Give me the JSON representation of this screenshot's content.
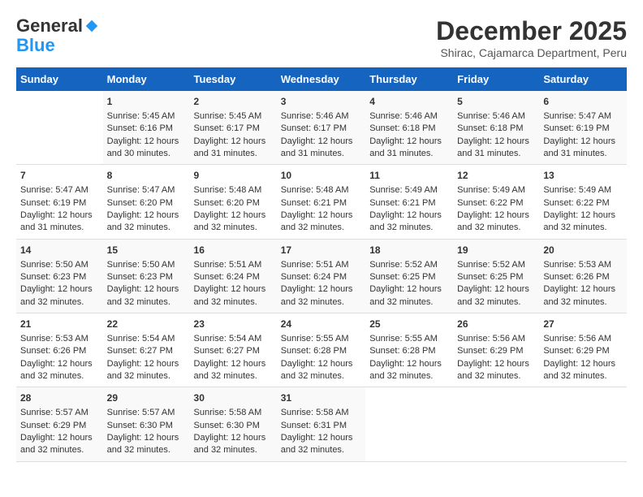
{
  "header": {
    "logo_line1": "General",
    "logo_line2": "Blue",
    "month_title": "December 2025",
    "location": "Shirac, Cajamarca Department, Peru"
  },
  "days_of_week": [
    "Sunday",
    "Monday",
    "Tuesday",
    "Wednesday",
    "Thursday",
    "Friday",
    "Saturday"
  ],
  "weeks": [
    [
      {
        "day": "",
        "sunrise": "",
        "sunset": "",
        "daylight": ""
      },
      {
        "day": "1",
        "sunrise": "Sunrise: 5:45 AM",
        "sunset": "Sunset: 6:16 PM",
        "daylight": "Daylight: 12 hours and 30 minutes."
      },
      {
        "day": "2",
        "sunrise": "Sunrise: 5:45 AM",
        "sunset": "Sunset: 6:17 PM",
        "daylight": "Daylight: 12 hours and 31 minutes."
      },
      {
        "day": "3",
        "sunrise": "Sunrise: 5:46 AM",
        "sunset": "Sunset: 6:17 PM",
        "daylight": "Daylight: 12 hours and 31 minutes."
      },
      {
        "day": "4",
        "sunrise": "Sunrise: 5:46 AM",
        "sunset": "Sunset: 6:18 PM",
        "daylight": "Daylight: 12 hours and 31 minutes."
      },
      {
        "day": "5",
        "sunrise": "Sunrise: 5:46 AM",
        "sunset": "Sunset: 6:18 PM",
        "daylight": "Daylight: 12 hours and 31 minutes."
      },
      {
        "day": "6",
        "sunrise": "Sunrise: 5:47 AM",
        "sunset": "Sunset: 6:19 PM",
        "daylight": "Daylight: 12 hours and 31 minutes."
      }
    ],
    [
      {
        "day": "7",
        "sunrise": "Sunrise: 5:47 AM",
        "sunset": "Sunset: 6:19 PM",
        "daylight": "Daylight: 12 hours and 31 minutes."
      },
      {
        "day": "8",
        "sunrise": "Sunrise: 5:47 AM",
        "sunset": "Sunset: 6:20 PM",
        "daylight": "Daylight: 12 hours and 32 minutes."
      },
      {
        "day": "9",
        "sunrise": "Sunrise: 5:48 AM",
        "sunset": "Sunset: 6:20 PM",
        "daylight": "Daylight: 12 hours and 32 minutes."
      },
      {
        "day": "10",
        "sunrise": "Sunrise: 5:48 AM",
        "sunset": "Sunset: 6:21 PM",
        "daylight": "Daylight: 12 hours and 32 minutes."
      },
      {
        "day": "11",
        "sunrise": "Sunrise: 5:49 AM",
        "sunset": "Sunset: 6:21 PM",
        "daylight": "Daylight: 12 hours and 32 minutes."
      },
      {
        "day": "12",
        "sunrise": "Sunrise: 5:49 AM",
        "sunset": "Sunset: 6:22 PM",
        "daylight": "Daylight: 12 hours and 32 minutes."
      },
      {
        "day": "13",
        "sunrise": "Sunrise: 5:49 AM",
        "sunset": "Sunset: 6:22 PM",
        "daylight": "Daylight: 12 hours and 32 minutes."
      }
    ],
    [
      {
        "day": "14",
        "sunrise": "Sunrise: 5:50 AM",
        "sunset": "Sunset: 6:23 PM",
        "daylight": "Daylight: 12 hours and 32 minutes."
      },
      {
        "day": "15",
        "sunrise": "Sunrise: 5:50 AM",
        "sunset": "Sunset: 6:23 PM",
        "daylight": "Daylight: 12 hours and 32 minutes."
      },
      {
        "day": "16",
        "sunrise": "Sunrise: 5:51 AM",
        "sunset": "Sunset: 6:24 PM",
        "daylight": "Daylight: 12 hours and 32 minutes."
      },
      {
        "day": "17",
        "sunrise": "Sunrise: 5:51 AM",
        "sunset": "Sunset: 6:24 PM",
        "daylight": "Daylight: 12 hours and 32 minutes."
      },
      {
        "day": "18",
        "sunrise": "Sunrise: 5:52 AM",
        "sunset": "Sunset: 6:25 PM",
        "daylight": "Daylight: 12 hours and 32 minutes."
      },
      {
        "day": "19",
        "sunrise": "Sunrise: 5:52 AM",
        "sunset": "Sunset: 6:25 PM",
        "daylight": "Daylight: 12 hours and 32 minutes."
      },
      {
        "day": "20",
        "sunrise": "Sunrise: 5:53 AM",
        "sunset": "Sunset: 6:26 PM",
        "daylight": "Daylight: 12 hours and 32 minutes."
      }
    ],
    [
      {
        "day": "21",
        "sunrise": "Sunrise: 5:53 AM",
        "sunset": "Sunset: 6:26 PM",
        "daylight": "Daylight: 12 hours and 32 minutes."
      },
      {
        "day": "22",
        "sunrise": "Sunrise: 5:54 AM",
        "sunset": "Sunset: 6:27 PM",
        "daylight": "Daylight: 12 hours and 32 minutes."
      },
      {
        "day": "23",
        "sunrise": "Sunrise: 5:54 AM",
        "sunset": "Sunset: 6:27 PM",
        "daylight": "Daylight: 12 hours and 32 minutes."
      },
      {
        "day": "24",
        "sunrise": "Sunrise: 5:55 AM",
        "sunset": "Sunset: 6:28 PM",
        "daylight": "Daylight: 12 hours and 32 minutes."
      },
      {
        "day": "25",
        "sunrise": "Sunrise: 5:55 AM",
        "sunset": "Sunset: 6:28 PM",
        "daylight": "Daylight: 12 hours and 32 minutes."
      },
      {
        "day": "26",
        "sunrise": "Sunrise: 5:56 AM",
        "sunset": "Sunset: 6:29 PM",
        "daylight": "Daylight: 12 hours and 32 minutes."
      },
      {
        "day": "27",
        "sunrise": "Sunrise: 5:56 AM",
        "sunset": "Sunset: 6:29 PM",
        "daylight": "Daylight: 12 hours and 32 minutes."
      }
    ],
    [
      {
        "day": "28",
        "sunrise": "Sunrise: 5:57 AM",
        "sunset": "Sunset: 6:29 PM",
        "daylight": "Daylight: 12 hours and 32 minutes."
      },
      {
        "day": "29",
        "sunrise": "Sunrise: 5:57 AM",
        "sunset": "Sunset: 6:30 PM",
        "daylight": "Daylight: 12 hours and 32 minutes."
      },
      {
        "day": "30",
        "sunrise": "Sunrise: 5:58 AM",
        "sunset": "Sunset: 6:30 PM",
        "daylight": "Daylight: 12 hours and 32 minutes."
      },
      {
        "day": "31",
        "sunrise": "Sunrise: 5:58 AM",
        "sunset": "Sunset: 6:31 PM",
        "daylight": "Daylight: 12 hours and 32 minutes."
      },
      {
        "day": "",
        "sunrise": "",
        "sunset": "",
        "daylight": ""
      },
      {
        "day": "",
        "sunrise": "",
        "sunset": "",
        "daylight": ""
      },
      {
        "day": "",
        "sunrise": "",
        "sunset": "",
        "daylight": ""
      }
    ]
  ]
}
